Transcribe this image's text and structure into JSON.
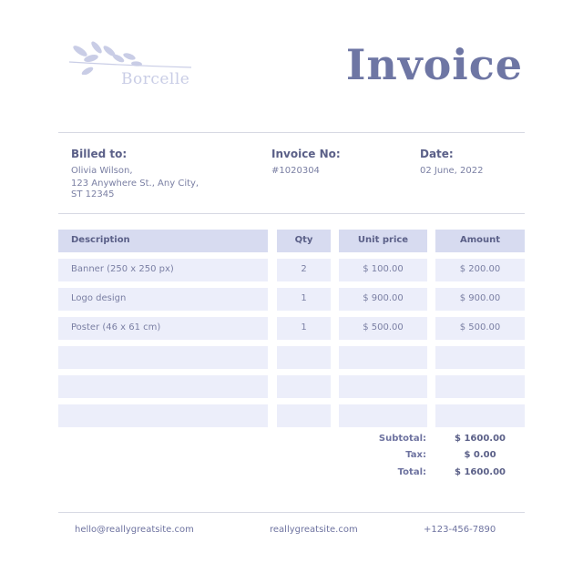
{
  "brand": {
    "name": "Borcelle"
  },
  "header": {
    "title": "Invoice"
  },
  "billed": {
    "label": "Billed to:",
    "name": "Olivia Wilson,",
    "address_line1": "123 Anywhere St., Any City,",
    "address_line2": "ST 12345"
  },
  "invoice": {
    "label": "Invoice No:",
    "number": "#1020304"
  },
  "date": {
    "label": "Date:",
    "value": "02 June, 2022"
  },
  "table": {
    "headers": {
      "description": "Description",
      "qty": "Qty",
      "unit_price": "Unit price",
      "amount": "Amount"
    },
    "rows": [
      {
        "description": "Banner (250 x 250 px)",
        "qty": "2",
        "unit_price": "$ 100.00",
        "amount": "$ 200.00"
      },
      {
        "description": "Logo design",
        "qty": "1",
        "unit_price": "$ 900.00",
        "amount": "$ 900.00"
      },
      {
        "description": "Poster (46 x 61 cm)",
        "qty": "1",
        "unit_price": "$ 500.00",
        "amount": "$ 500.00"
      }
    ]
  },
  "summary": {
    "subtotal_label": "Subtotal:",
    "subtotal": "$ 1600.00",
    "tax_label": "Tax:",
    "tax": "$ 0.00",
    "total_label": "Total:",
    "total": "$ 1600.00"
  },
  "footer": {
    "email": "hello@reallygreatsite.com",
    "website": "reallygreatsite.com",
    "phone": "+123-456-7890"
  },
  "colors": {
    "accent": "#6e76a4",
    "header_cell": "#d7dbf0",
    "body_cell": "#eceefa"
  }
}
